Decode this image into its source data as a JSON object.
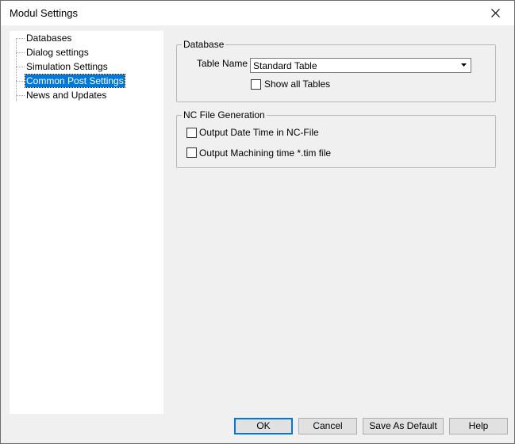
{
  "window": {
    "title": "Modul Settings"
  },
  "tree": {
    "items": [
      {
        "label": "Databases",
        "selected": false
      },
      {
        "label": "Dialog settings",
        "selected": false
      },
      {
        "label": "Simulation Settings",
        "selected": false
      },
      {
        "label": "Common Post Settings",
        "selected": true
      },
      {
        "label": "News and Updates",
        "selected": false
      }
    ]
  },
  "database_group": {
    "legend": "Database",
    "table_name_label": "Table Name",
    "table_name_value": "Standard Table",
    "show_all_tables_label": "Show all Tables",
    "show_all_tables_checked": false
  },
  "nc_group": {
    "legend": "NC File Generation",
    "output_date_time_label": "Output Date Time in NC-File",
    "output_date_time_checked": false,
    "output_machining_time_label": "Output Machining time *.tim file",
    "output_machining_time_checked": false
  },
  "buttons": {
    "ok": "OK",
    "cancel": "Cancel",
    "save_default": "Save As Default",
    "help": "Help"
  },
  "colors": {
    "selection": "#0078d7",
    "dialog_bg": "#f0f0f0"
  }
}
